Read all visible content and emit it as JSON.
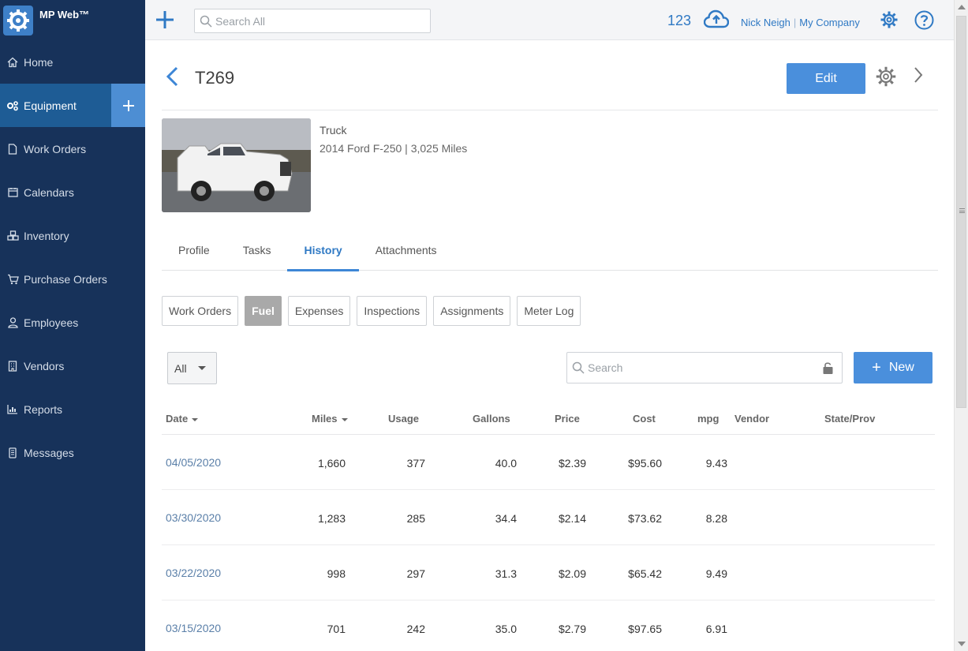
{
  "app": {
    "name": "MP Web™"
  },
  "colors": {
    "sidebar": "#17325a",
    "active_nav": "#1e5c95",
    "accent": "#4a8fdc",
    "link": "#2f79c4"
  },
  "sidebar": {
    "items": [
      {
        "label": "Home",
        "icon": "home-icon"
      },
      {
        "label": "Equipment",
        "icon": "gears-icon",
        "active": true
      },
      {
        "label": "Work Orders",
        "icon": "document-icon"
      },
      {
        "label": "Calendars",
        "icon": "calendar-icon"
      },
      {
        "label": "Inventory",
        "icon": "boxes-icon"
      },
      {
        "label": "Purchase Orders",
        "icon": "cart-icon"
      },
      {
        "label": "Employees",
        "icon": "person-icon"
      },
      {
        "label": "Vendors",
        "icon": "building-icon"
      },
      {
        "label": "Reports",
        "icon": "bar-chart-icon"
      },
      {
        "label": "Messages",
        "icon": "phone-icon"
      }
    ]
  },
  "topbar": {
    "search_placeholder": "Search All",
    "count": "123",
    "user": "Nick Neigh",
    "separator": "|",
    "company": "My Company"
  },
  "header": {
    "title": "T269",
    "edit_label": "Edit"
  },
  "summary": {
    "type": "Truck",
    "description": "2014 Ford F-250 | 3,025 Miles"
  },
  "tabs": [
    "Profile",
    "Tasks",
    "History",
    "Attachments"
  ],
  "active_tab": "History",
  "subtabs": [
    "Work Orders",
    "Fuel",
    "Expenses",
    "Inspections",
    "Assignments",
    "Meter Log"
  ],
  "active_subtab": "Fuel",
  "filter": {
    "selected": "All"
  },
  "table_search": {
    "placeholder": "Search"
  },
  "new_label": "New",
  "table": {
    "headers": {
      "date": "Date",
      "miles": "Miles",
      "usage": "Usage",
      "gallons": "Gallons",
      "price": "Price",
      "cost": "Cost",
      "mpg": "mpg",
      "vendor": "Vendor",
      "state": "State/Prov"
    },
    "rows": [
      {
        "date": "04/05/2020",
        "miles": "1,660",
        "usage": "377",
        "gallons": "40.0",
        "price": "$2.39",
        "cost": "$95.60",
        "mpg": "9.43"
      },
      {
        "date": "03/30/2020",
        "miles": "1,283",
        "usage": "285",
        "gallons": "34.4",
        "price": "$2.14",
        "cost": "$73.62",
        "mpg": "8.28"
      },
      {
        "date": "03/22/2020",
        "miles": "998",
        "usage": "297",
        "gallons": "31.3",
        "price": "$2.09",
        "cost": "$65.42",
        "mpg": "9.49"
      },
      {
        "date": "03/15/2020",
        "miles": "701",
        "usage": "242",
        "gallons": "35.0",
        "price": "$2.79",
        "cost": "$97.65",
        "mpg": "6.91"
      }
    ]
  }
}
